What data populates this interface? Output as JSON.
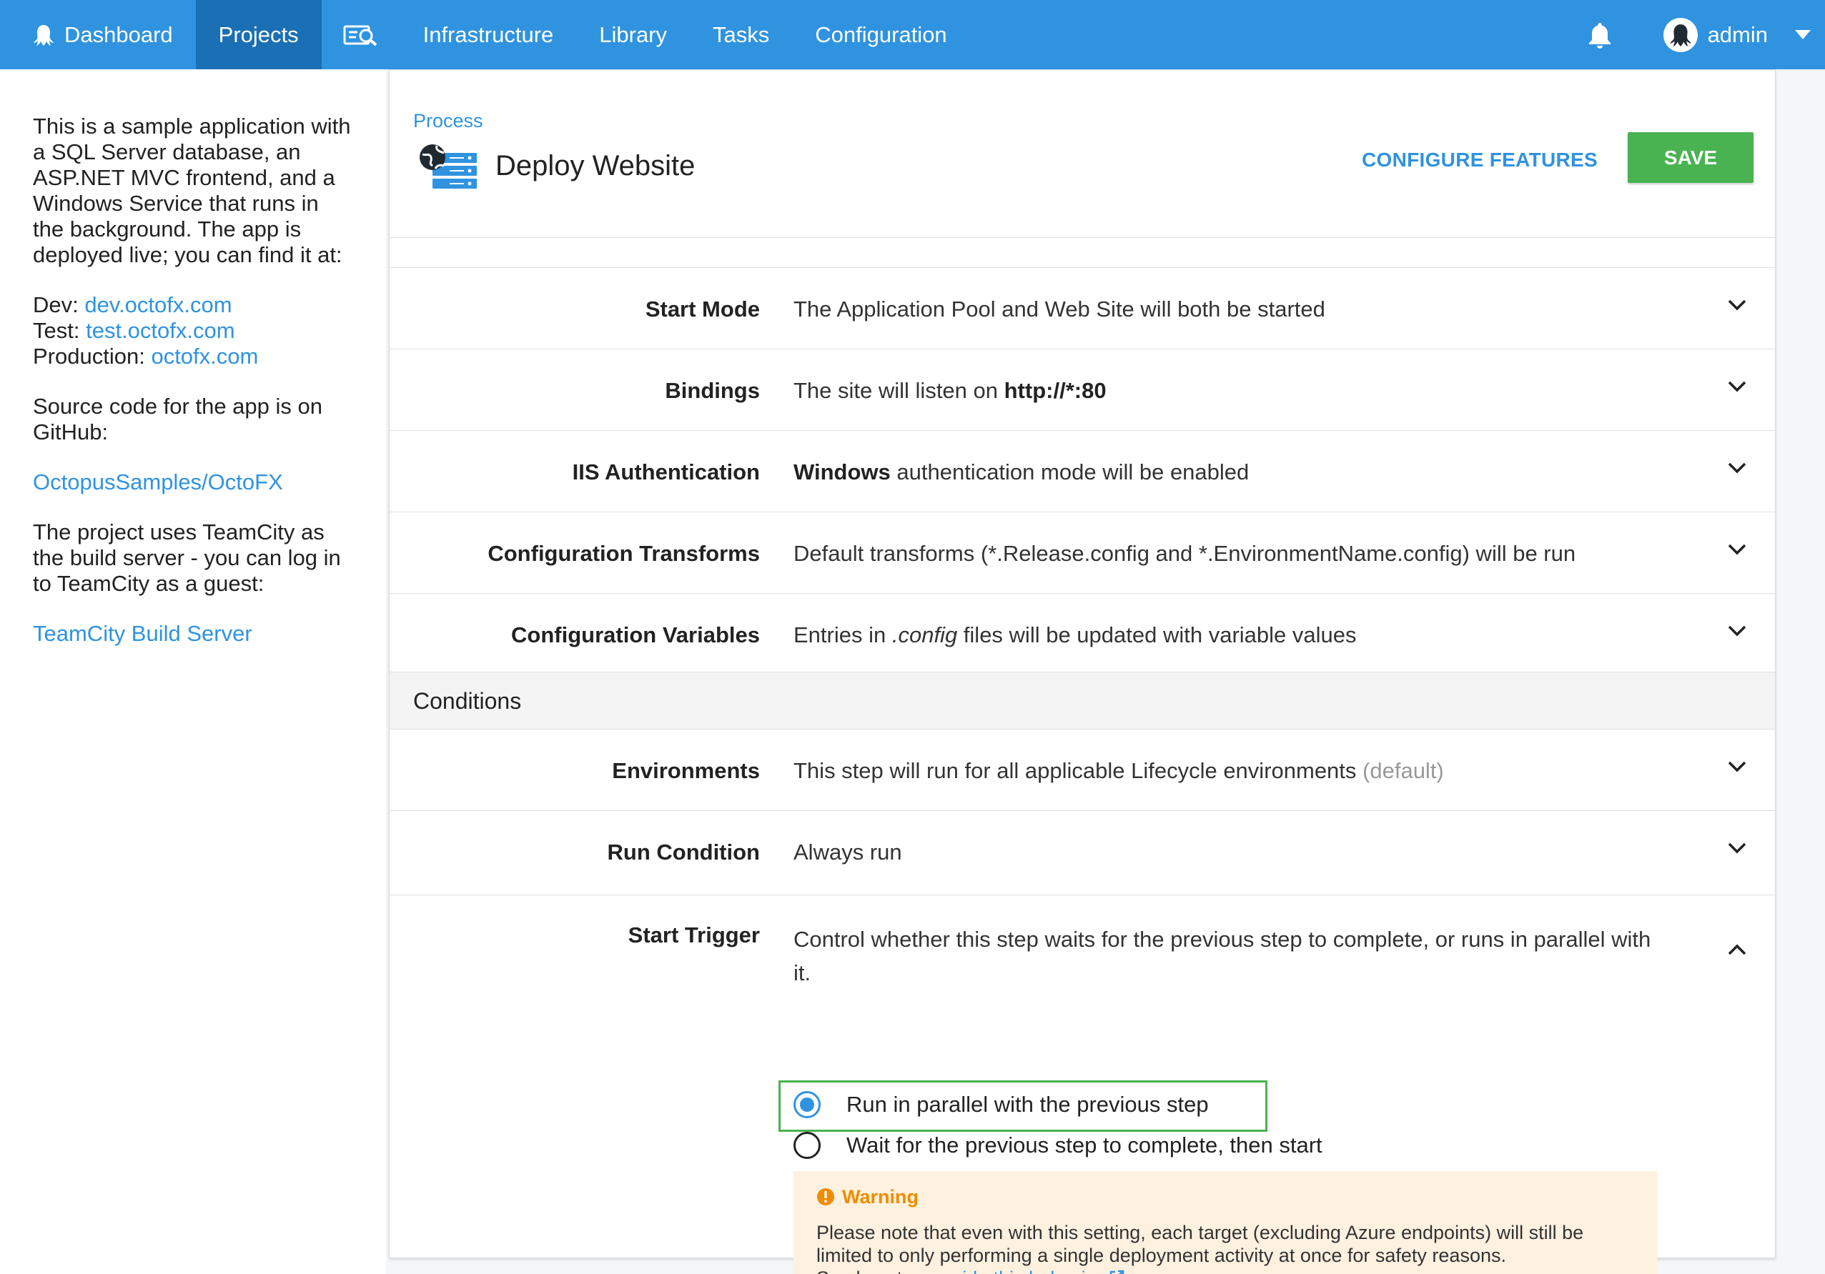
{
  "nav": {
    "dashboard": "Dashboard",
    "projects": "Projects",
    "infrastructure": "Infrastructure",
    "library": "Library",
    "tasks": "Tasks",
    "configuration": "Configuration",
    "user": "admin"
  },
  "sidebar": {
    "intro": "This is a sample application with a SQL Server database, an ASP.NET MVC frontend, and a Windows Service that runs in the background. The app is deployed live; you can find it at:",
    "dev_label": "Dev:",
    "dev_link": "dev.octofx.com",
    "test_label": "Test:",
    "test_link": "test.octofx.com",
    "prod_label": "Production:",
    "prod_link": "octofx.com",
    "source_text": "Source code for the app is on GitHub:",
    "github_link": "OctopusSamples/OctoFX",
    "teamcity_text": "The project uses TeamCity as the build server - you can log in to TeamCity as a guest:",
    "teamcity_link": "TeamCity Build Server"
  },
  "header": {
    "breadcrumb": "Process",
    "title": "Deploy Website",
    "configure_features": "CONFIGURE FEATURES",
    "save": "SAVE"
  },
  "rows": {
    "start_mode": {
      "label": "Start Mode",
      "value": "The Application Pool and Web Site will both be started"
    },
    "bindings": {
      "label": "Bindings",
      "prefix": "The site will listen on ",
      "bold": "http://*:80"
    },
    "iis_auth": {
      "label": "IIS Authentication",
      "bold": "Windows",
      "suffix": " authentication mode will be enabled"
    },
    "config_transforms": {
      "label": "Configuration Transforms",
      "value": "Default transforms (*.Release.config and *.EnvironmentName.config) will be run"
    },
    "config_variables": {
      "label": "Configuration Variables",
      "prefix": "Entries in ",
      "italic": ".config",
      "suffix": " files will be updated with variable values"
    }
  },
  "conditions": {
    "heading": "Conditions",
    "environments": {
      "label": "Environments",
      "value": "This step will run for all applicable Lifecycle environments ",
      "muted": "(default)"
    },
    "run_condition": {
      "label": "Run Condition",
      "value": "Always run"
    },
    "start_trigger": {
      "label": "Start Trigger",
      "description": "Control whether this step waits for the previous step to complete, or runs in parallel with it.",
      "options": [
        {
          "label": "Run in parallel with the previous step",
          "selected": true
        },
        {
          "label": "Wait for the previous step to complete, then start",
          "selected": false
        }
      ]
    }
  },
  "warning": {
    "title": "Warning",
    "body": "Please note that even with this setting, each target (excluding Azure endpoints) will still be limited to only performing a single deployment activity at once for safety reasons.",
    "see_how": "See how to ",
    "link": "override this behavior",
    "end": "."
  },
  "colors": {
    "nav_bg": "#2f93e0",
    "nav_active": "#1a6fb5",
    "link": "#2f93e0",
    "save_green": "#48b350",
    "warning_bg": "#fff1e0",
    "warning_text": "#f08c00"
  }
}
